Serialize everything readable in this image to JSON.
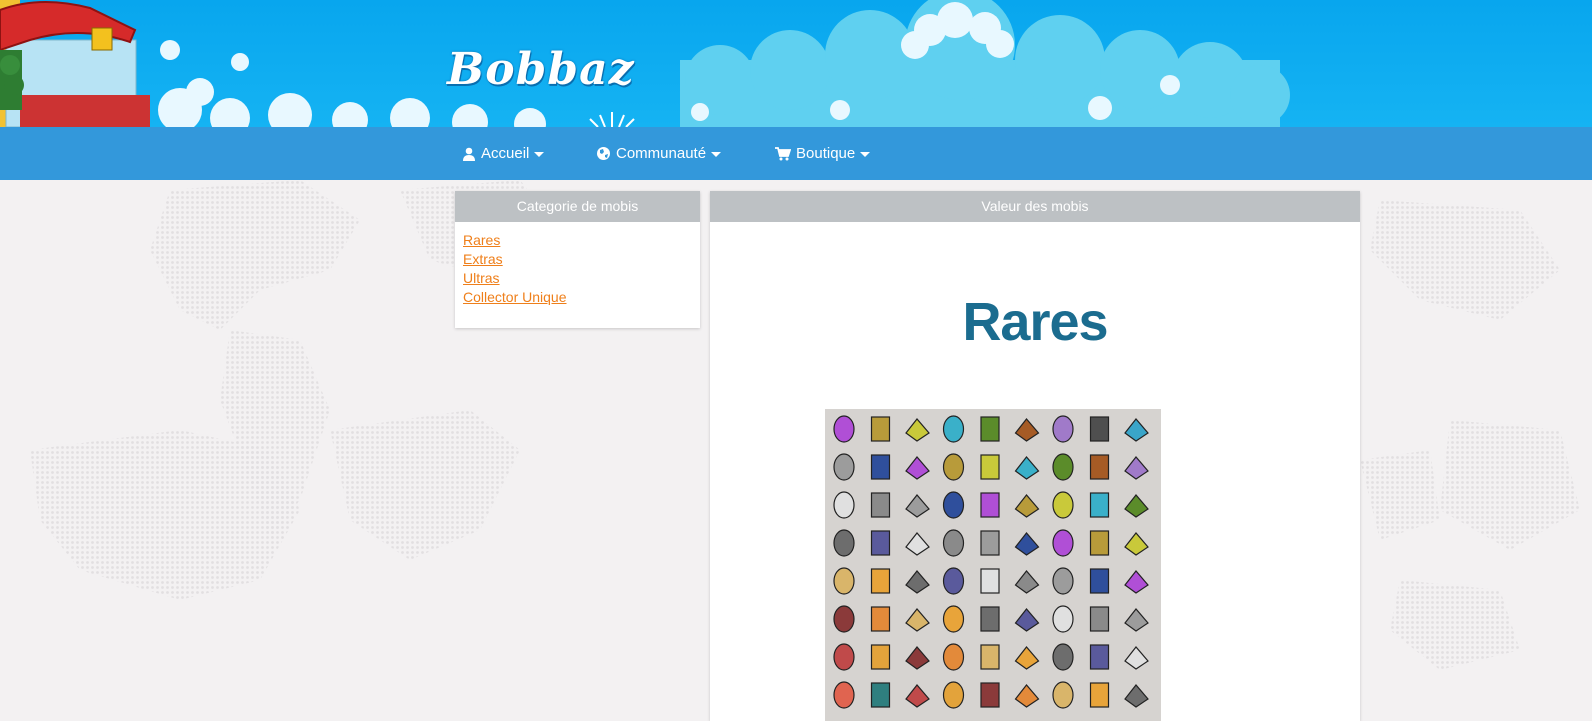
{
  "site": {
    "logo_text": "Bobbaz"
  },
  "nav": {
    "items": [
      {
        "label": "Accueil",
        "icon": "user-icon"
      },
      {
        "label": "Communauté",
        "icon": "globe-icon"
      },
      {
        "label": "Boutique",
        "icon": "cart-icon"
      }
    ]
  },
  "sidebar": {
    "title": "Categorie de mobis",
    "links": [
      "Rares",
      "Extras",
      "Ultras",
      "Collector Unique"
    ]
  },
  "main": {
    "title": "Valeur des mobis",
    "heading": "Rares"
  },
  "colors": {
    "banner": "#0aa8ef",
    "navbar": "#3398db",
    "panel_head": "#bdc1c4",
    "link": "#ef7f1a",
    "heading": "#1b6c8f"
  }
}
